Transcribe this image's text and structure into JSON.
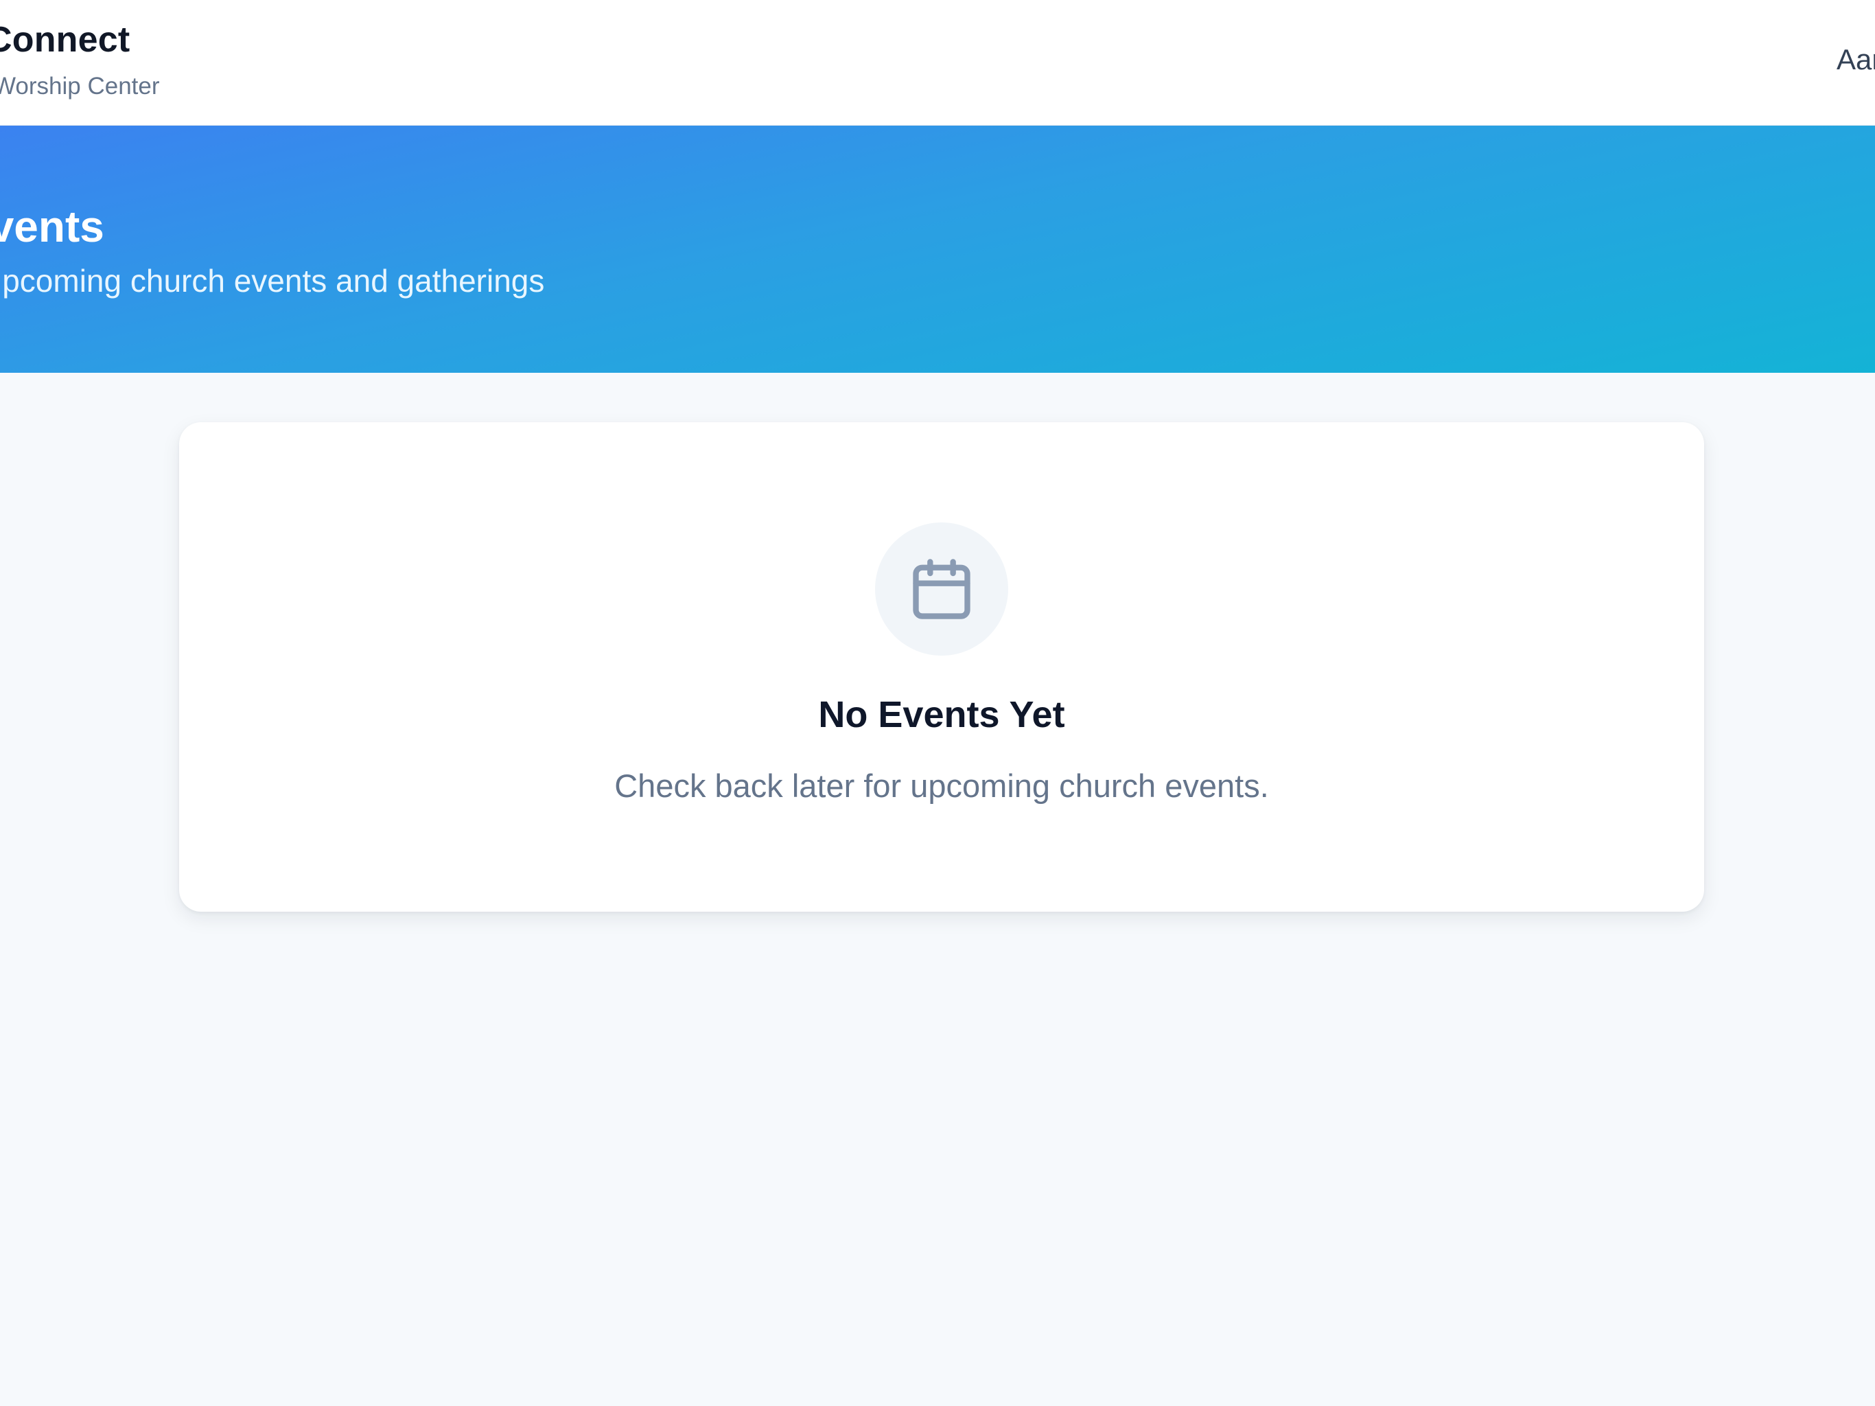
{
  "header": {
    "brand_name": "Connect",
    "brand_subtitle": "Worship Center",
    "user_name": "Aaron"
  },
  "hero": {
    "title": "Events",
    "subtitle": "Upcoming church events and gatherings"
  },
  "empty_state": {
    "icon": "calendar-icon",
    "title": "No Events Yet",
    "message": "Check back later for upcoming church events."
  },
  "colors": {
    "gradient_start": "#3b82f0",
    "gradient_end": "#14b3d6",
    "page_background": "#f6f9fc",
    "card_background": "#ffffff",
    "icon_gray": "#8a9bb3"
  }
}
